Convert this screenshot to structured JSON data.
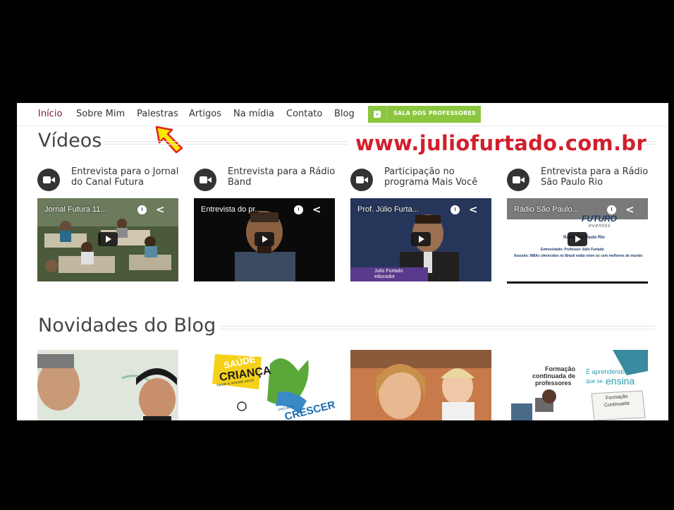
{
  "nav": {
    "items": [
      "Início",
      "Sobre Mim",
      "Palestras",
      "Artigos",
      "Na mídia",
      "Contato",
      "Blog"
    ],
    "button_label": "SALA DOS PROFESSORES"
  },
  "videos": {
    "title": "Vídeos",
    "site_url": "www.juliofurtado.com.br",
    "items": [
      {
        "title": "Entrevista para o Jornal do Canal Futura",
        "thumb_caption": "Jornal Futura 11..."
      },
      {
        "title": "Entrevista para a Rádio Band",
        "thumb_caption": "Entrevista do pr..."
      },
      {
        "title": "Participação no programa Mais Você",
        "thumb_caption": "Prof. Júlio Furta...",
        "overlay": "Julio Furtado",
        "overlay_sub": "educador"
      },
      {
        "title": "Entrevista para a Rádio São Paulo Rio",
        "thumb_caption": "Rádio São Paulo...",
        "logo": "FUTURO",
        "logo_sub": "eventos",
        "line1": "Rádio São Paulo Rio",
        "line2": "Entrevistado: Professor Júlio Furtado",
        "line3": "Assunto: MBAs oferecidos no Brasil estão entre os cem melhores do mundo"
      }
    ]
  },
  "blog": {
    "title": "Novidades do Blog",
    "card2": {
      "logo_line1": "SAÚDE",
      "logo_line2": "CRIANÇA",
      "tagline": "Saúde & inclusão social",
      "project": "PROJETO",
      "project_name": "CRESCER"
    },
    "card4": {
      "line1": "Formação",
      "line2": "continuada de",
      "line3": "professores",
      "right1": "É aprendendo",
      "right2": "que se",
      "right3": "ensina",
      "box1": "Formação",
      "box2": "Continuada"
    }
  },
  "colors": {
    "accent": "#7b1a3a",
    "button": "#8cc63f",
    "url": "#d11f2c"
  }
}
